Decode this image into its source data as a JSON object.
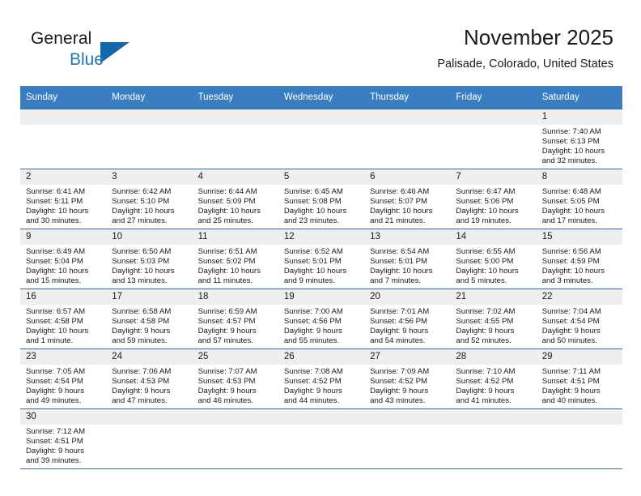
{
  "brand": {
    "name_part1": "General",
    "name_part2": "Blue",
    "logo_icon": "blue-triangle-logo",
    "accent_color": "#1567ac"
  },
  "header": {
    "title": "November 2025",
    "location": "Palisade, Colorado, United States"
  },
  "theme": {
    "header_row_bg": "#3a7dc0",
    "grid_line": "#2e6da8",
    "daynum_bg": "#efefef",
    "text": "#1a1a1a"
  },
  "weekdays": [
    "Sunday",
    "Monday",
    "Tuesday",
    "Wednesday",
    "Thursday",
    "Friday",
    "Saturday"
  ],
  "weeks": [
    [
      {
        "day": "",
        "blank": true
      },
      {
        "day": "",
        "blank": true
      },
      {
        "day": "",
        "blank": true
      },
      {
        "day": "",
        "blank": true
      },
      {
        "day": "",
        "blank": true
      },
      {
        "day": "",
        "blank": true
      },
      {
        "day": "1",
        "sunrise": "Sunrise: 7:40 AM",
        "sunset": "Sunset: 6:13 PM",
        "daylight1": "Daylight: 10 hours",
        "daylight2": "and 32 minutes."
      }
    ],
    [
      {
        "day": "2",
        "sunrise": "Sunrise: 6:41 AM",
        "sunset": "Sunset: 5:11 PM",
        "daylight1": "Daylight: 10 hours",
        "daylight2": "and 30 minutes."
      },
      {
        "day": "3",
        "sunrise": "Sunrise: 6:42 AM",
        "sunset": "Sunset: 5:10 PM",
        "daylight1": "Daylight: 10 hours",
        "daylight2": "and 27 minutes."
      },
      {
        "day": "4",
        "sunrise": "Sunrise: 6:44 AM",
        "sunset": "Sunset: 5:09 PM",
        "daylight1": "Daylight: 10 hours",
        "daylight2": "and 25 minutes."
      },
      {
        "day": "5",
        "sunrise": "Sunrise: 6:45 AM",
        "sunset": "Sunset: 5:08 PM",
        "daylight1": "Daylight: 10 hours",
        "daylight2": "and 23 minutes."
      },
      {
        "day": "6",
        "sunrise": "Sunrise: 6:46 AM",
        "sunset": "Sunset: 5:07 PM",
        "daylight1": "Daylight: 10 hours",
        "daylight2": "and 21 minutes."
      },
      {
        "day": "7",
        "sunrise": "Sunrise: 6:47 AM",
        "sunset": "Sunset: 5:06 PM",
        "daylight1": "Daylight: 10 hours",
        "daylight2": "and 19 minutes."
      },
      {
        "day": "8",
        "sunrise": "Sunrise: 6:48 AM",
        "sunset": "Sunset: 5:05 PM",
        "daylight1": "Daylight: 10 hours",
        "daylight2": "and 17 minutes."
      }
    ],
    [
      {
        "day": "9",
        "sunrise": "Sunrise: 6:49 AM",
        "sunset": "Sunset: 5:04 PM",
        "daylight1": "Daylight: 10 hours",
        "daylight2": "and 15 minutes."
      },
      {
        "day": "10",
        "sunrise": "Sunrise: 6:50 AM",
        "sunset": "Sunset: 5:03 PM",
        "daylight1": "Daylight: 10 hours",
        "daylight2": "and 13 minutes."
      },
      {
        "day": "11",
        "sunrise": "Sunrise: 6:51 AM",
        "sunset": "Sunset: 5:02 PM",
        "daylight1": "Daylight: 10 hours",
        "daylight2": "and 11 minutes."
      },
      {
        "day": "12",
        "sunrise": "Sunrise: 6:52 AM",
        "sunset": "Sunset: 5:01 PM",
        "daylight1": "Daylight: 10 hours",
        "daylight2": "and 9 minutes."
      },
      {
        "day": "13",
        "sunrise": "Sunrise: 6:54 AM",
        "sunset": "Sunset: 5:01 PM",
        "daylight1": "Daylight: 10 hours",
        "daylight2": "and 7 minutes."
      },
      {
        "day": "14",
        "sunrise": "Sunrise: 6:55 AM",
        "sunset": "Sunset: 5:00 PM",
        "daylight1": "Daylight: 10 hours",
        "daylight2": "and 5 minutes."
      },
      {
        "day": "15",
        "sunrise": "Sunrise: 6:56 AM",
        "sunset": "Sunset: 4:59 PM",
        "daylight1": "Daylight: 10 hours",
        "daylight2": "and 3 minutes."
      }
    ],
    [
      {
        "day": "16",
        "sunrise": "Sunrise: 6:57 AM",
        "sunset": "Sunset: 4:58 PM",
        "daylight1": "Daylight: 10 hours",
        "daylight2": "and 1 minute."
      },
      {
        "day": "17",
        "sunrise": "Sunrise: 6:58 AM",
        "sunset": "Sunset: 4:58 PM",
        "daylight1": "Daylight: 9 hours",
        "daylight2": "and 59 minutes."
      },
      {
        "day": "18",
        "sunrise": "Sunrise: 6:59 AM",
        "sunset": "Sunset: 4:57 PM",
        "daylight1": "Daylight: 9 hours",
        "daylight2": "and 57 minutes."
      },
      {
        "day": "19",
        "sunrise": "Sunrise: 7:00 AM",
        "sunset": "Sunset: 4:56 PM",
        "daylight1": "Daylight: 9 hours",
        "daylight2": "and 55 minutes."
      },
      {
        "day": "20",
        "sunrise": "Sunrise: 7:01 AM",
        "sunset": "Sunset: 4:56 PM",
        "daylight1": "Daylight: 9 hours",
        "daylight2": "and 54 minutes."
      },
      {
        "day": "21",
        "sunrise": "Sunrise: 7:02 AM",
        "sunset": "Sunset: 4:55 PM",
        "daylight1": "Daylight: 9 hours",
        "daylight2": "and 52 minutes."
      },
      {
        "day": "22",
        "sunrise": "Sunrise: 7:04 AM",
        "sunset": "Sunset: 4:54 PM",
        "daylight1": "Daylight: 9 hours",
        "daylight2": "and 50 minutes."
      }
    ],
    [
      {
        "day": "23",
        "sunrise": "Sunrise: 7:05 AM",
        "sunset": "Sunset: 4:54 PM",
        "daylight1": "Daylight: 9 hours",
        "daylight2": "and 49 minutes."
      },
      {
        "day": "24",
        "sunrise": "Sunrise: 7:06 AM",
        "sunset": "Sunset: 4:53 PM",
        "daylight1": "Daylight: 9 hours",
        "daylight2": "and 47 minutes."
      },
      {
        "day": "25",
        "sunrise": "Sunrise: 7:07 AM",
        "sunset": "Sunset: 4:53 PM",
        "daylight1": "Daylight: 9 hours",
        "daylight2": "and 46 minutes."
      },
      {
        "day": "26",
        "sunrise": "Sunrise: 7:08 AM",
        "sunset": "Sunset: 4:52 PM",
        "daylight1": "Daylight: 9 hours",
        "daylight2": "and 44 minutes."
      },
      {
        "day": "27",
        "sunrise": "Sunrise: 7:09 AM",
        "sunset": "Sunset: 4:52 PM",
        "daylight1": "Daylight: 9 hours",
        "daylight2": "and 43 minutes."
      },
      {
        "day": "28",
        "sunrise": "Sunrise: 7:10 AM",
        "sunset": "Sunset: 4:52 PM",
        "daylight1": "Daylight: 9 hours",
        "daylight2": "and 41 minutes."
      },
      {
        "day": "29",
        "sunrise": "Sunrise: 7:11 AM",
        "sunset": "Sunset: 4:51 PM",
        "daylight1": "Daylight: 9 hours",
        "daylight2": "and 40 minutes."
      }
    ],
    [
      {
        "day": "30",
        "sunrise": "Sunrise: 7:12 AM",
        "sunset": "Sunset: 4:51 PM",
        "daylight1": "Daylight: 9 hours",
        "daylight2": "and 39 minutes."
      },
      {
        "day": "",
        "blank": true
      },
      {
        "day": "",
        "blank": true
      },
      {
        "day": "",
        "blank": true
      },
      {
        "day": "",
        "blank": true
      },
      {
        "day": "",
        "blank": true
      },
      {
        "day": "",
        "blank": true
      }
    ]
  ]
}
